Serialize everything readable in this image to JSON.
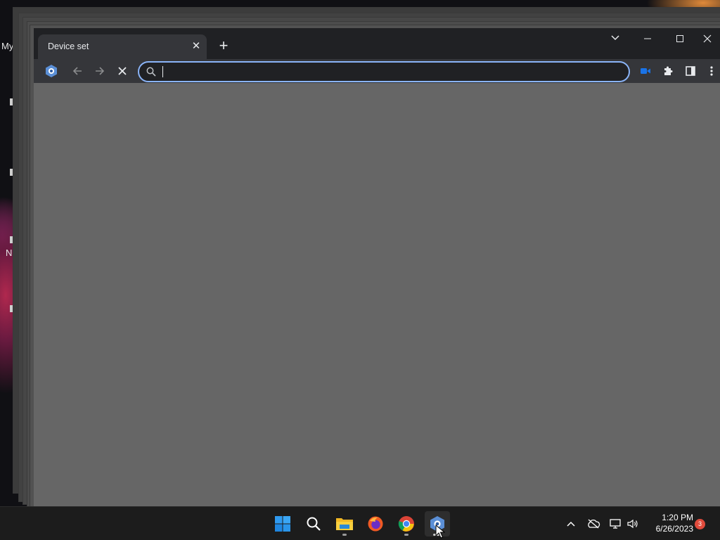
{
  "desktop": {
    "label_top": "My",
    "label_mid": "N"
  },
  "browser": {
    "tab": {
      "title": "Device set",
      "close_glyph": "✕"
    },
    "new_tab_glyph": "+",
    "window_controls": {
      "tab_search": "⌵",
      "minimize": "—",
      "maximize": "☐",
      "close": "✕"
    },
    "toolbar": {
      "omnibox": {
        "value": "",
        "placeholder": ""
      }
    },
    "page_background": "#666666"
  },
  "taskbar": {
    "apps": [
      "start-icon",
      "search-icon",
      "file-explorer-icon",
      "firefox-icon",
      "chrome-icon",
      "app-hexagon-icon"
    ],
    "clock": {
      "time": "1:20 PM",
      "date": "6/26/2023"
    },
    "notification_count": "3"
  },
  "colors": {
    "accent": "#8ab4f8",
    "tab_bg": "#35363a",
    "frame_bg": "#202124",
    "taskbar_bg": "#1c1c1c",
    "badge": "#e04b3c"
  }
}
